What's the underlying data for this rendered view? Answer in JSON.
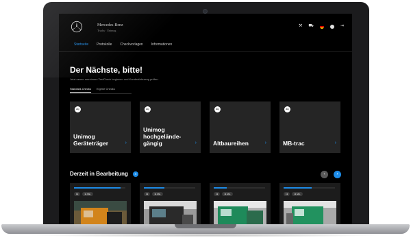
{
  "header": {
    "brand_name": "Mercedes-Benz",
    "brand_sub": "Trucks · Unimog",
    "icons": [
      "tools-icon",
      "truck-icon",
      "flag-de-icon",
      "user-icon",
      "logout-icon"
    ]
  },
  "nav": {
    "items": [
      {
        "label": "Startseite",
        "active": true
      },
      {
        "label": "Protokolle",
        "active": false
      },
      {
        "label": "Checkvorlagen",
        "active": false
      },
      {
        "label": "Informationen",
        "active": false
      }
    ]
  },
  "hero": {
    "title": "Der Nächste, bitte!",
    "subtitle": "Jetzt neuen mercimmo TestCheck beginnen und Kundenfahrzeug prüfen."
  },
  "segments": {
    "items": [
      {
        "label": "Standard-Checks",
        "selected": true
      },
      {
        "label": "Eigene Checks",
        "selected": false
      }
    ]
  },
  "cards": [
    {
      "badge": "dry",
      "title": "Unimog Geräteträger"
    },
    {
      "badge": "dry",
      "title": "Unimog hochgelände-gängig"
    },
    {
      "badge": "dry",
      "title": "Altbaureihen"
    },
    {
      "badge": "dry",
      "title": "MB-trac"
    }
  ],
  "wip": {
    "title": "Derzeit in Bearbeitung",
    "count": "4",
    "pager_prev": "‹",
    "pager_next": "›",
    "items": [
      {
        "progress": 0.9,
        "chip_a": "13",
        "chip_b": "11 Min."
      },
      {
        "progress": 0.4,
        "chip_a": "13",
        "chip_b": "11 Min."
      },
      {
        "progress": 0.25,
        "chip_a": "13",
        "chip_b": "11 Min."
      },
      {
        "progress": 0.55,
        "chip_a": "13",
        "chip_b": "11 Min."
      }
    ]
  },
  "colors": {
    "accent": "#1d8ce8",
    "background": "#000000",
    "card": "#252525"
  }
}
